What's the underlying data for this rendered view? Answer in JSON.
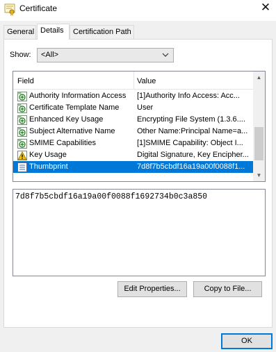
{
  "window": {
    "title": "Certificate",
    "close_glyph": "✕"
  },
  "tabs": [
    {
      "label": "General"
    },
    {
      "label": "Details"
    },
    {
      "label": "Certification Path"
    }
  ],
  "show": {
    "label": "Show:",
    "value": "<All>"
  },
  "list": {
    "columns": [
      "Field",
      "Value"
    ],
    "rows": [
      {
        "icon": "cert-extension-icon",
        "field": "Authority Information Access",
        "value": "[1]Authority Info Access: Acc..."
      },
      {
        "icon": "cert-extension-icon",
        "field": "Certificate Template Name",
        "value": "User"
      },
      {
        "icon": "cert-extension-icon",
        "field": "Enhanced Key Usage",
        "value": "Encrypting File System (1.3.6...."
      },
      {
        "icon": "cert-extension-icon",
        "field": "Subject Alternative Name",
        "value": "Other Name:Principal Name=a..."
      },
      {
        "icon": "cert-extension-icon",
        "field": "SMIME Capabilities",
        "value": "[1]SMIME Capability: Object I..."
      },
      {
        "icon": "cert-critical-extension-icon",
        "field": "Key Usage",
        "value": "Digital Signature, Key Encipher..."
      },
      {
        "icon": "cert-property-icon",
        "field": "Thumbprint",
        "value": "7d8f7b5cbdf16a19a00f0088f1..."
      }
    ],
    "selected_index": 6
  },
  "detail_value": "7d8f7b5cbdf16a19a00f0088f1692734b0c3a850",
  "buttons": {
    "edit_properties": "Edit Properties...",
    "copy_to_file": "Copy to File...",
    "ok": "OK"
  },
  "colors": {
    "selection": "#0078d7",
    "window_bg": "#f0f0f0",
    "panel_bg": "#ffffff"
  }
}
